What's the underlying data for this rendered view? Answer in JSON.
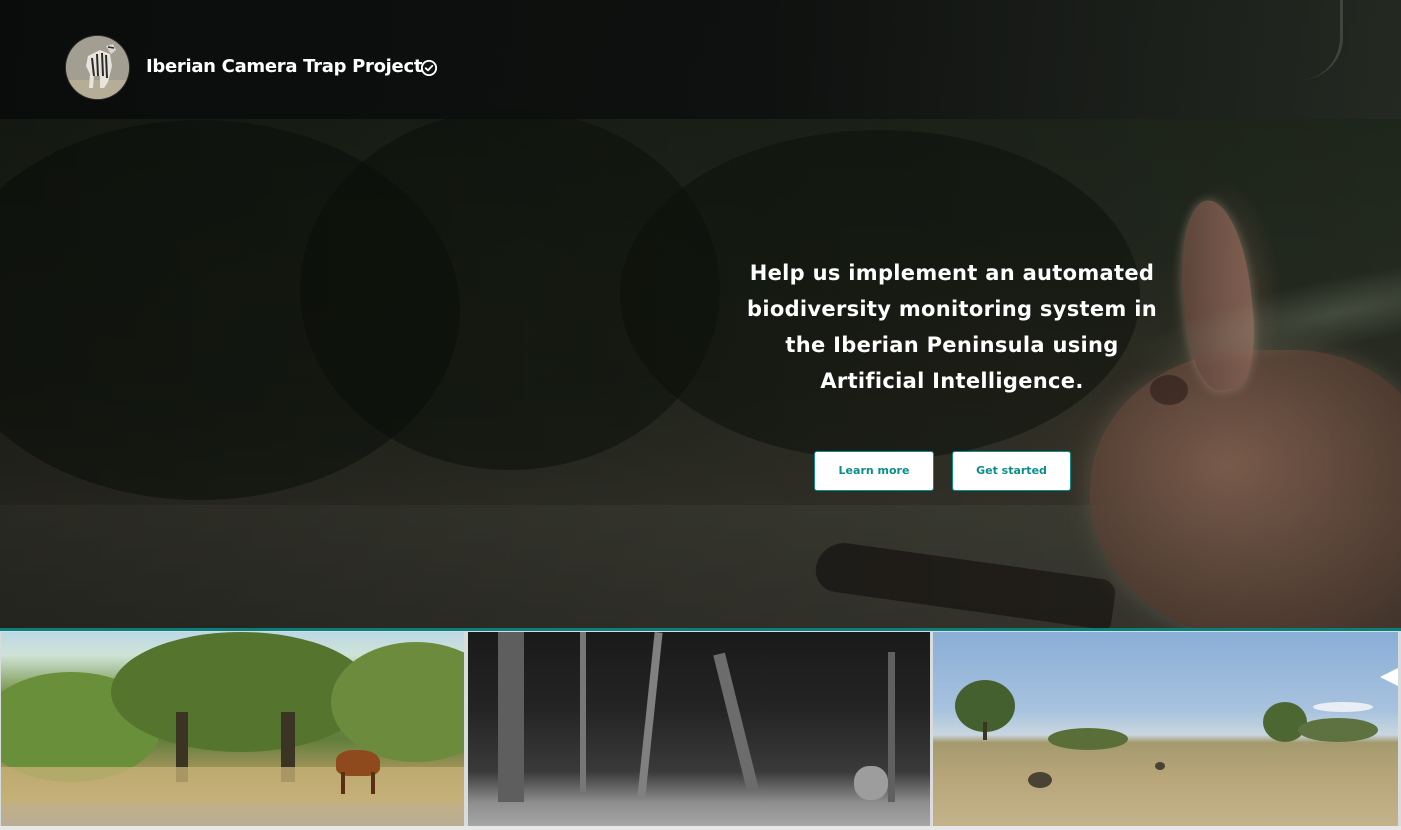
{
  "header": {
    "project_title": "Iberian Camera Trap Project",
    "verified_icon": "verified-check-icon",
    "avatar_icon": "project-avatar-image"
  },
  "hero": {
    "message": "Help us implement an automated biodiversity monitoring system in the Iberian Peninsula using Artificial Intelligence.",
    "buttons": {
      "learn_more": "Learn more",
      "get_started": "Get started"
    }
  },
  "gallery": {
    "slider_arrow_icon": "chevron-left-icon"
  },
  "colors": {
    "accent": "#0c8d8a",
    "divider": "#0c7f7c",
    "header_background": "#0e100f",
    "text_on_dark": "#ffffff"
  }
}
